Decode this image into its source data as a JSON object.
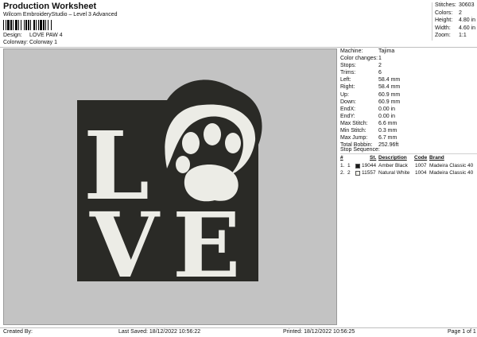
{
  "header": {
    "title": "Production Worksheet",
    "subtitle": "Wilcom EmbroideryStudio – Level 3 Advanced"
  },
  "design": {
    "design_label": "Design:",
    "design_value": "LOVE PAW 4",
    "colorway_label": "Colorway:",
    "colorway_value": "Colorway 1"
  },
  "stats": [
    {
      "label": "Stitches:",
      "value": "30603"
    },
    {
      "label": "Colors:",
      "value": "2"
    },
    {
      "label": "Height:",
      "value": "4.80 in"
    },
    {
      "label": "Width:",
      "value": "4.60 in"
    },
    {
      "label": "Zoom:",
      "value": "1:1"
    }
  ],
  "details": [
    {
      "label": "Machine:",
      "value": "Tajima"
    },
    {
      "label": "Color changes:",
      "value": "1"
    },
    {
      "label": "Stops:",
      "value": "2"
    },
    {
      "label": "Trims:",
      "value": "6"
    },
    {
      "label": "Left:",
      "value": "58.4 mm"
    },
    {
      "label": "Right:",
      "value": "58.4 mm"
    },
    {
      "label": "Up:",
      "value": "60.9 mm"
    },
    {
      "label": "Down:",
      "value": "60.9 mm"
    },
    {
      "label": "EndX:",
      "value": "0.00 in"
    },
    {
      "label": "EndY:",
      "value": "0.00 in"
    },
    {
      "label": "Max Stitch:",
      "value": "6.6 mm"
    },
    {
      "label": "Min Stitch:",
      "value": "0.3 mm"
    },
    {
      "label": "Max Jump:",
      "value": "6.7 mm"
    },
    {
      "label": "Total Bobbin:",
      "value": "252.96ft"
    }
  ],
  "stop_sequence": {
    "title": "Stop Sequence:",
    "headers": {
      "n": "#",
      "st": "St.",
      "description": "Description",
      "code": "Code",
      "brand": "Brand"
    },
    "rows": [
      {
        "index": "1.",
        "stop": "1",
        "st": "19044",
        "description": "Amber Black",
        "code": "1007",
        "brand": "Madeira Classic 40",
        "swatch": "#1a1a1a"
      },
      {
        "index": "2.",
        "stop": "2",
        "st": "11557",
        "description": "Natural White",
        "code": "1004",
        "brand": "Madeira Classic 40",
        "swatch": "#f0f0ea"
      }
    ]
  },
  "footer": {
    "created_by": "Created By:",
    "last_saved": "Last Saved: 18/12/2022 10:56:22",
    "printed": "Printed: 18/12/2022 10:56:25",
    "page": "Page 1 of 1"
  },
  "preview": {
    "word_letters": [
      "L",
      "V",
      "E"
    ],
    "colors": {
      "background": "#c3c3c3",
      "dark": "#2a2a26",
      "light": "#ecece6"
    }
  }
}
